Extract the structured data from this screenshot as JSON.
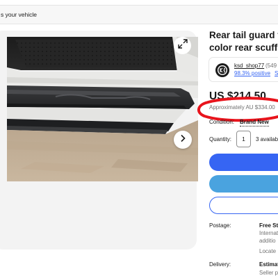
{
  "vehicle_bar": {
    "text": "s your vehicle"
  },
  "product": {
    "title_line1": "Rear tail guard fo",
    "title_line2": "color rear scuff p"
  },
  "seller": {
    "name": "ksd_shop77",
    "feedback_count": "(549",
    "positive": "98.3% positive",
    "separator": "·",
    "link": "S"
  },
  "price": {
    "main": "US $214.50",
    "approx": "Approximately AU $334.00"
  },
  "condition": {
    "label": "Condition:",
    "value": "Brand New"
  },
  "quantity": {
    "label": "Quantity:",
    "value": "1",
    "available": "3 availab"
  },
  "shipping": {
    "postage_label": "Postage:",
    "postage_value": "Free St",
    "postage_line2": "Internat",
    "postage_line3": "additio",
    "postage_line4": "Locate",
    "delivery_label": "Delivery:",
    "delivery_value": "Estimat",
    "delivery_line2": "Seller p"
  },
  "icons": {
    "expand": "expand-icon",
    "next": "chevron-right-icon",
    "avatar": "seller-logo"
  },
  "colors": {
    "accent_blue": "#3665f3",
    "light_blue": "#4aa3df",
    "annotation_red": "#e8141c",
    "muted_text": "#707070"
  }
}
